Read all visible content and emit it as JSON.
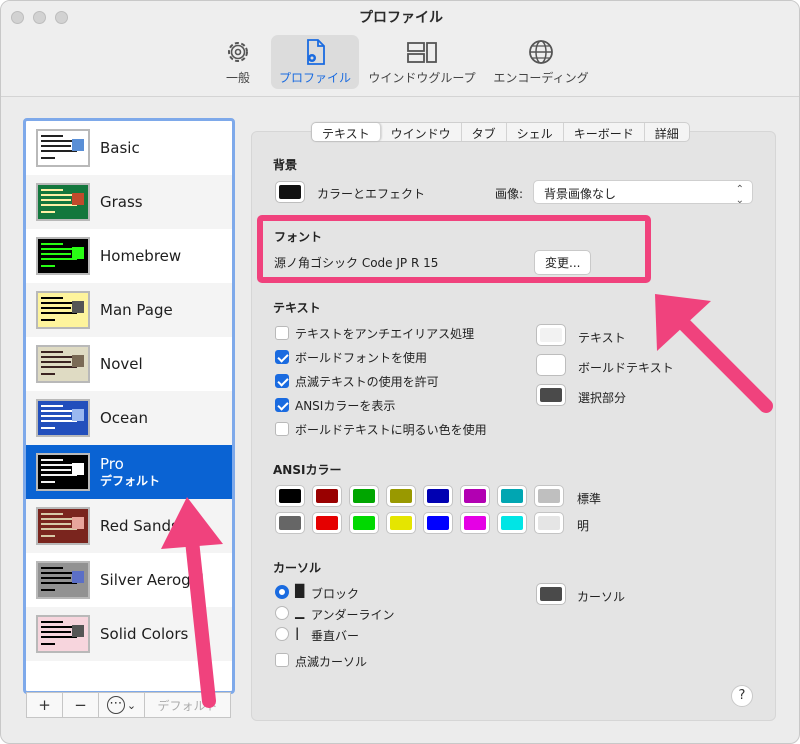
{
  "window": {
    "title": "プロファイル"
  },
  "toolbar": {
    "items": [
      {
        "label": "一般",
        "icon": "gear-icon"
      },
      {
        "label": "プロファイル",
        "icon": "document-gear-icon",
        "active": true
      },
      {
        "label": "ウインドウグループ",
        "icon": "window-group-icon"
      },
      {
        "label": "エンコーディング",
        "icon": "globe-icon"
      }
    ]
  },
  "profiles": [
    {
      "name": "Basic",
      "bg": "#ffffff",
      "fg": "#222222",
      "accent": "#5a8fd6"
    },
    {
      "name": "Grass",
      "bg": "#13773d",
      "fg": "#fff0a5",
      "accent": "#c14a2c"
    },
    {
      "name": "Homebrew",
      "bg": "#000000",
      "fg": "#28fe14",
      "accent": "#28fe14"
    },
    {
      "name": "Man Page",
      "bg": "#fef49c",
      "fg": "#000000",
      "accent": "#555555"
    },
    {
      "name": "Novel",
      "bg": "#dfdbc3",
      "fg": "#3b2322",
      "accent": "#7a6a55"
    },
    {
      "name": "Ocean",
      "bg": "#224fbc",
      "fg": "#ffffff",
      "accent": "#9ab8f0"
    },
    {
      "name": "Pro",
      "sub": "デフォルト",
      "bg": "#000000",
      "fg": "#f2f2f2",
      "accent": "#ffffff",
      "selected": true
    },
    {
      "name": "Red Sands",
      "bg": "#7a251e",
      "fg": "#d7c9a7",
      "accent": "#e8a59c"
    },
    {
      "name": "Silver Aerogel",
      "bg": "#929292",
      "fg": "#000000",
      "accent": "#5b6fc7"
    },
    {
      "name": "Solid Colors",
      "bg": "#f7d5dd",
      "fg": "#000000",
      "accent": "#555555"
    }
  ],
  "sidebar_buttons": {
    "add": "+",
    "remove": "−",
    "more": "⋯",
    "more_arrow": "⌄",
    "default": "デフォルト"
  },
  "tabs": [
    "テキスト",
    "ウインドウ",
    "タブ",
    "シェル",
    "キーボード",
    "詳細"
  ],
  "background": {
    "heading": "背景",
    "color_effect_label": "カラーとエフェクト",
    "color": "#111111",
    "image_label": "画像:",
    "image_value": "背景画像なし"
  },
  "font": {
    "heading": "フォント",
    "name": "源ノ角ゴシック Code JP R 15",
    "change_button": "変更..."
  },
  "text": {
    "heading": "テキスト",
    "options": [
      {
        "label": "テキストをアンチエイリアス処理",
        "checked": false
      },
      {
        "label": "ボールドフォントを使用",
        "checked": true
      },
      {
        "label": "点滅テキストの使用を許可",
        "checked": true
      },
      {
        "label": "ANSIカラーを表示",
        "checked": true
      },
      {
        "label": "ボールドテキストに明るい色を使用",
        "checked": false
      }
    ],
    "colors": [
      {
        "label": "テキスト",
        "color": "#f2f2f2"
      },
      {
        "label": "ボールドテキスト",
        "color": "#ffffff"
      },
      {
        "label": "選択部分",
        "color": "#4a4a4a"
      }
    ]
  },
  "ansi": {
    "heading": "ANSIカラー",
    "normal_label": "標準",
    "bright_label": "明",
    "normal": [
      "#000000",
      "#990000",
      "#00a600",
      "#999900",
      "#0000b2",
      "#b200b2",
      "#00a6b2",
      "#bfbfbf"
    ],
    "bright": [
      "#666666",
      "#e50000",
      "#00d900",
      "#e5e500",
      "#0000ff",
      "#e500e5",
      "#00e5e5",
      "#e5e5e5"
    ]
  },
  "cursor": {
    "heading": "カーソル",
    "options": [
      {
        "label": "ブロック",
        "glyph": "█",
        "selected": true
      },
      {
        "label": "アンダーライン",
        "glyph": "▁",
        "selected": false
      },
      {
        "label": "垂直バー",
        "glyph": "|",
        "selected": false
      }
    ],
    "blink_label": "点滅カーソル",
    "color_label": "カーソル",
    "color": "#4a4a4a"
  },
  "help": "?",
  "annotation_color": "#f0427d"
}
